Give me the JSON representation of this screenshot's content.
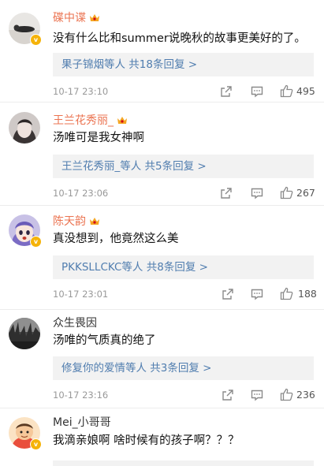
{
  "comments": [
    {
      "username": "碟中谍",
      "name_color": "#eb7350",
      "text": "没有什么比和summer说晚秋的故事更美好的了。",
      "reply_lead": "果子锦烟等人",
      "reply_count": "共18条回复 >",
      "timestamp": "10-17 23:10",
      "likes": "495"
    },
    {
      "username": "王兰花秀丽_",
      "name_color": "#eb7350",
      "text": "汤唯可是我女神啊",
      "reply_lead": "王兰花秀丽_等人",
      "reply_count": "共5条回复 >",
      "timestamp": "10-17 23:06",
      "likes": "267"
    },
    {
      "username": "陈天韵",
      "name_color": "#eb7350",
      "text": "真没想到，他竟然这么美",
      "reply_lead": "PKKSLLCKC等人",
      "reply_count": "共8条回复 >",
      "timestamp": "10-17 23:01",
      "likes": "188"
    },
    {
      "username": "众生畏因",
      "name_color": "#333333",
      "text": "汤唯的气质真的绝了",
      "reply_lead": "修复你的爱情等人",
      "reply_count": "共3条回复 >",
      "timestamp": "10-17 23:16",
      "likes": "236"
    },
    {
      "username": "Mei_小哥哥",
      "name_color": "#333333",
      "text": "我滴亲娘啊  啥时候有的孩子啊？？？"
    }
  ],
  "icons": {
    "share": "share-icon",
    "comment": "comment-icon",
    "like": "thumbs-up-icon",
    "verified": "verified-badge-icon",
    "crown": "vip-crown-icon"
  }
}
